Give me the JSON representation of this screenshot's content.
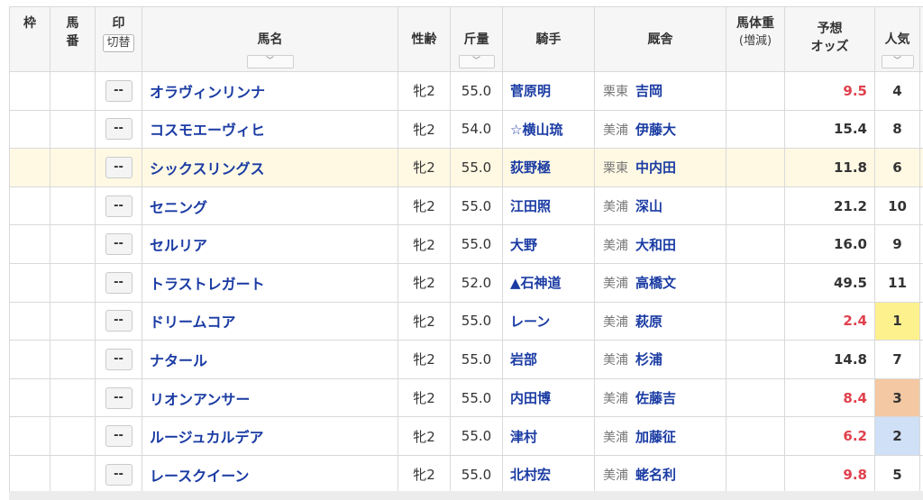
{
  "header": {
    "waku": "枠",
    "umaban": "馬番",
    "mark": "印",
    "mark_toggle": "切替",
    "horse_name": "馬名",
    "sex_age": "性齢",
    "kinryo": "斤量",
    "jockey": "騎手",
    "trainer": "厩舎",
    "weight": "馬体重",
    "weight_sub": "(増減)",
    "odds_line1": "予想",
    "odds_line2": "オッズ",
    "popularity": "人気",
    "sort_glyph": "﹀"
  },
  "mark_placeholder": "--",
  "rows": [
    {
      "name": "オラヴィンリンナ",
      "sexage": "牝2",
      "kinryo": "55.0",
      "jockey": "菅原明",
      "region": "栗東",
      "trainer": "吉岡",
      "odds": "9.5",
      "pop": "4"
    },
    {
      "name": "コスモエーヴィヒ",
      "sexage": "牝2",
      "kinryo": "54.0",
      "jockey": "☆横山琉",
      "region": "美浦",
      "trainer": "伊藤大",
      "odds": "15.4",
      "pop": "8"
    },
    {
      "name": "シックスリングス",
      "sexage": "牝2",
      "kinryo": "55.0",
      "jockey": "荻野極",
      "region": "栗東",
      "trainer": "中内田",
      "odds": "11.8",
      "pop": "6"
    },
    {
      "name": "セニング",
      "sexage": "牝2",
      "kinryo": "55.0",
      "jockey": "江田照",
      "region": "美浦",
      "trainer": "深山",
      "odds": "21.2",
      "pop": "10"
    },
    {
      "name": "セルリア",
      "sexage": "牝2",
      "kinryo": "55.0",
      "jockey": "大野",
      "region": "美浦",
      "trainer": "大和田",
      "odds": "16.0",
      "pop": "9"
    },
    {
      "name": "トラストレガート",
      "sexage": "牝2",
      "kinryo": "52.0",
      "jockey": "▲石神道",
      "region": "美浦",
      "trainer": "高橋文",
      "odds": "49.5",
      "pop": "11"
    },
    {
      "name": "ドリームコア",
      "sexage": "牝2",
      "kinryo": "55.0",
      "jockey": "レーン",
      "region": "美浦",
      "trainer": "萩原",
      "odds": "2.4",
      "pop": "1"
    },
    {
      "name": "ナタール",
      "sexage": "牝2",
      "kinryo": "55.0",
      "jockey": "岩部",
      "region": "美浦",
      "trainer": "杉浦",
      "odds": "14.8",
      "pop": "7"
    },
    {
      "name": "リオンアンサー",
      "sexage": "牝2",
      "kinryo": "55.0",
      "jockey": "内田博",
      "region": "美浦",
      "trainer": "佐藤吉",
      "odds": "8.4",
      "pop": "3"
    },
    {
      "name": "ルージュカルデア",
      "sexage": "牝2",
      "kinryo": "55.0",
      "jockey": "津村",
      "region": "美浦",
      "trainer": "加藤征",
      "odds": "6.2",
      "pop": "2"
    },
    {
      "name": "レースクイーン",
      "sexage": "牝2",
      "kinryo": "55.0",
      "jockey": "北村宏",
      "region": "美浦",
      "trainer": "蛯名利",
      "odds": "9.8",
      "pop": "5"
    }
  ],
  "colors": {
    "link": "#1a3ba3",
    "fav_odds": "#e0414d",
    "highlight_row": "#fff9e3",
    "pop1": "#fdf18e",
    "pop2": "#cfe0f7",
    "pop3": "#f3c8a2"
  }
}
